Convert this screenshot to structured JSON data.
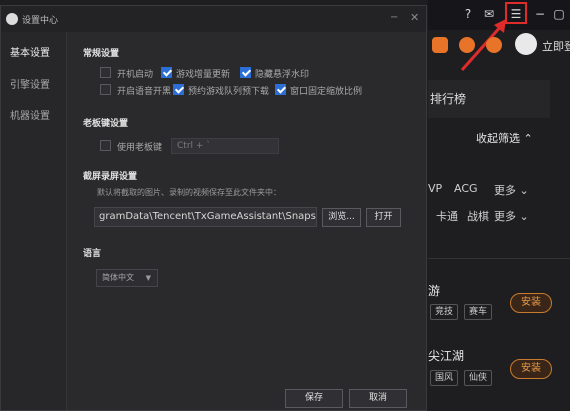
{
  "dialog": {
    "title": "设置中心",
    "min_glyph": "−",
    "close_glyph": "✕"
  },
  "sidebar": {
    "items": [
      {
        "label": "基本设置"
      },
      {
        "label": "引擎设置"
      },
      {
        "label": "机器设置"
      }
    ]
  },
  "general": {
    "title": "常规设置",
    "options": [
      {
        "label": "开机启动",
        "checked": false
      },
      {
        "label": "游戏增量更新",
        "checked": true
      },
      {
        "label": "隐藏悬浮水印",
        "checked": true
      },
      {
        "label": "开启语音开黑",
        "checked": false
      },
      {
        "label": "预约游戏队列预下载",
        "checked": true
      },
      {
        "label": "窗口固定缩放比例",
        "checked": true
      }
    ]
  },
  "boss_key": {
    "title": "老板键设置",
    "label": "使用老板键",
    "checked": false,
    "hotkey": "Ctrl + `"
  },
  "screenshot": {
    "title": "截屏录屏设置",
    "hint": "默认将截取的图片、录制的视频保存至此文件夹中：",
    "path": "gramData\\Tencent\\TxGameAssistant\\Snapshot",
    "browse_label": "浏览...",
    "open_label": "打开"
  },
  "language": {
    "title": "语言",
    "selected": "简体中文"
  },
  "footer": {
    "save_label": "保存",
    "cancel_label": "取消"
  },
  "app": {
    "login_text": "立即登",
    "rank_label": "排行榜",
    "filter_label": "收起筛选",
    "tags_row1": [
      "VP",
      "ACG",
      "更多"
    ],
    "tags_row2": [
      "卡通",
      "战棋",
      "更多"
    ],
    "game1": {
      "title": "游",
      "chips": [
        "竞技",
        "赛车"
      ],
      "install": "安装"
    },
    "game2": {
      "title": "尖江湖",
      "chips": [
        "国风",
        "仙侠"
      ],
      "install": "安装"
    }
  },
  "colors": {
    "accent": "#2b6fd6",
    "highlight_box": "#e02b2b",
    "install": "#e89a4a"
  }
}
